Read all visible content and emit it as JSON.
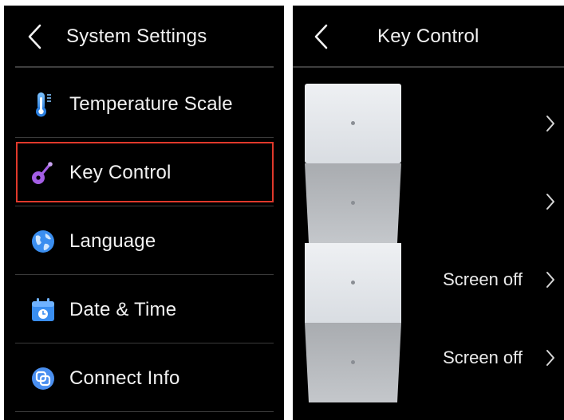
{
  "system_settings": {
    "title": "System Settings",
    "items": [
      {
        "label": "Temperature Scale",
        "icon": "thermometer-icon"
      },
      {
        "label": "Key Control",
        "icon": "guitar-key-icon",
        "highlighted": true
      },
      {
        "label": "Language",
        "icon": "globe-icon"
      },
      {
        "label": "Date & Time",
        "icon": "calendar-clock-icon"
      },
      {
        "label": "Connect Info",
        "icon": "connect-info-icon"
      }
    ],
    "highlight_color": "#e0392b"
  },
  "key_control": {
    "title": "Key Control",
    "keys": [
      {
        "value": "",
        "icon": "chevron-right-icon"
      },
      {
        "value": "",
        "icon": "chevron-right-icon"
      },
      {
        "value": "Screen off",
        "icon": "chevron-right-icon"
      },
      {
        "value": "Screen off",
        "icon": "chevron-right-icon"
      }
    ]
  },
  "colors": {
    "background": "#000000",
    "text": "#f2f2f2",
    "divider": "#3a3a3a"
  }
}
